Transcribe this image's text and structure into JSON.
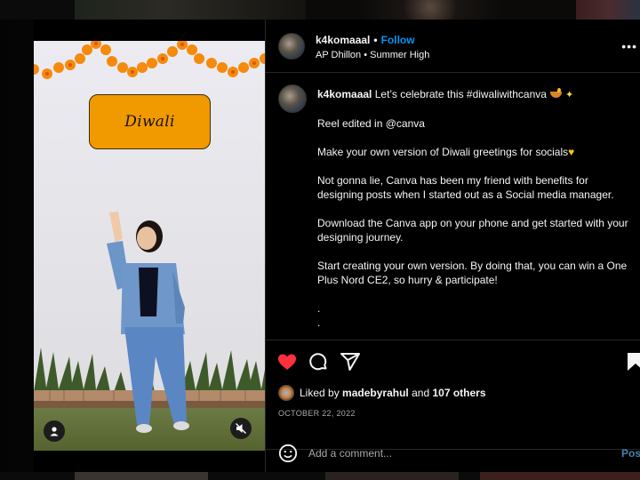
{
  "post": {
    "username": "k4komaaal",
    "follow_label": "Follow",
    "separator": "•",
    "audio": "AP Dhillon • Summer High",
    "more_icon": "more-horizontal-icon",
    "reel_text": "Diwali"
  },
  "caption": {
    "username": "k4komaaal",
    "line1": "Let’s celebrate this #diwaliwithcanva",
    "line1_emojis": [
      "diya-emoji",
      "sparkles-emoji"
    ],
    "paragraphs": [
      "Reel edited in @canva",
      "Make your own version of Diwali greetings for socials",
      "Not gonna lie, Canva has been my friend with benefits for designing posts when I started out as a Social media manager.",
      "Download the Canva app on your phone and get started with your designing journey.",
      "Start creating your own version. By doing that, you can win a One Plus Nord CE2, so hurry & participate!",
      ".",
      "."
    ],
    "yellow_heart": "💛"
  },
  "actions": {
    "liked": true,
    "like_color": "#ff3040",
    "icons": [
      "heart-icon",
      "comment-icon",
      "share-icon",
      "bookmark-icon"
    ]
  },
  "likes": {
    "prefix": "Liked by",
    "user": "madebyrahul",
    "and": "and",
    "count_text": "107 others"
  },
  "date": "OCTOBER 22, 2022",
  "comment": {
    "placeholder": "Add a comment...",
    "post_label": "Post"
  },
  "colors": {
    "accent": "#0095f6",
    "background": "#000000",
    "text": "#f5f5f5",
    "muted": "#a8a8a8",
    "card": "#f09a00"
  }
}
